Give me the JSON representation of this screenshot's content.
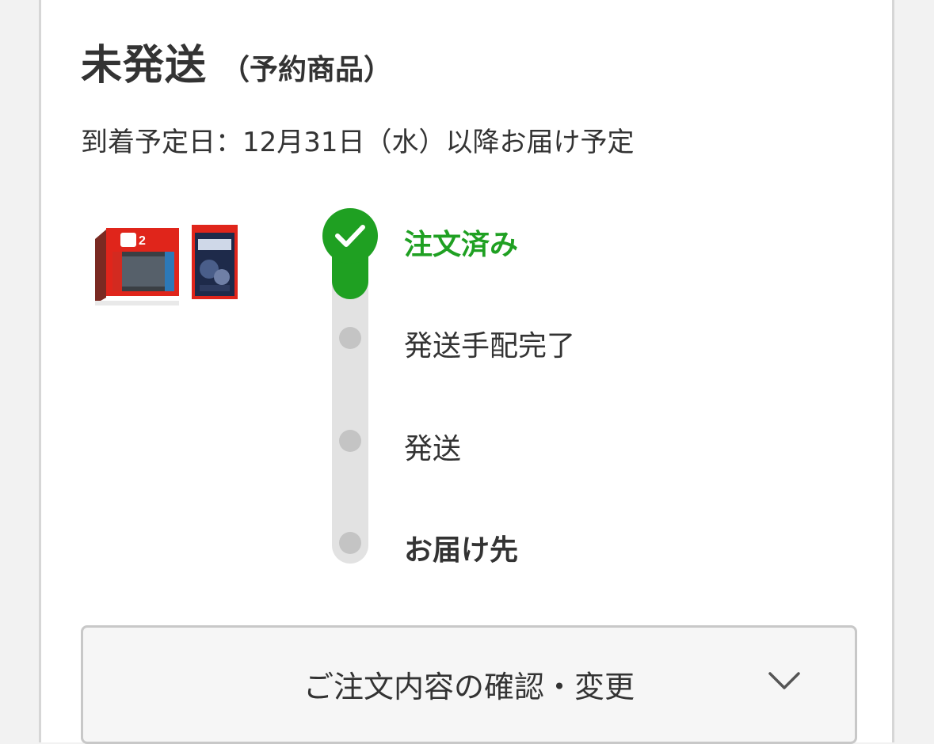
{
  "header": {
    "title": "未発送",
    "subtitle": "（予約商品）"
  },
  "arrival": {
    "text": "到着予定日：12月31日（水）以降お届け予定"
  },
  "products": [
    {
      "icon": "console-box-image"
    },
    {
      "icon": "game-box-image"
    }
  ],
  "progress": {
    "steps": [
      {
        "label": "注文済み",
        "state": "done"
      },
      {
        "label": "発送手配完了",
        "state": "pending"
      },
      {
        "label": "発送",
        "state": "pending"
      },
      {
        "label": "お届け先",
        "state": "pending"
      }
    ],
    "completed_steps": 1
  },
  "actions": {
    "confirm_label": "ご注文内容の確認・変更"
  },
  "colors": {
    "accent": "#1fa022",
    "text": "#333333",
    "track": "#e2e2e2",
    "dot": "#c4c4c4"
  }
}
